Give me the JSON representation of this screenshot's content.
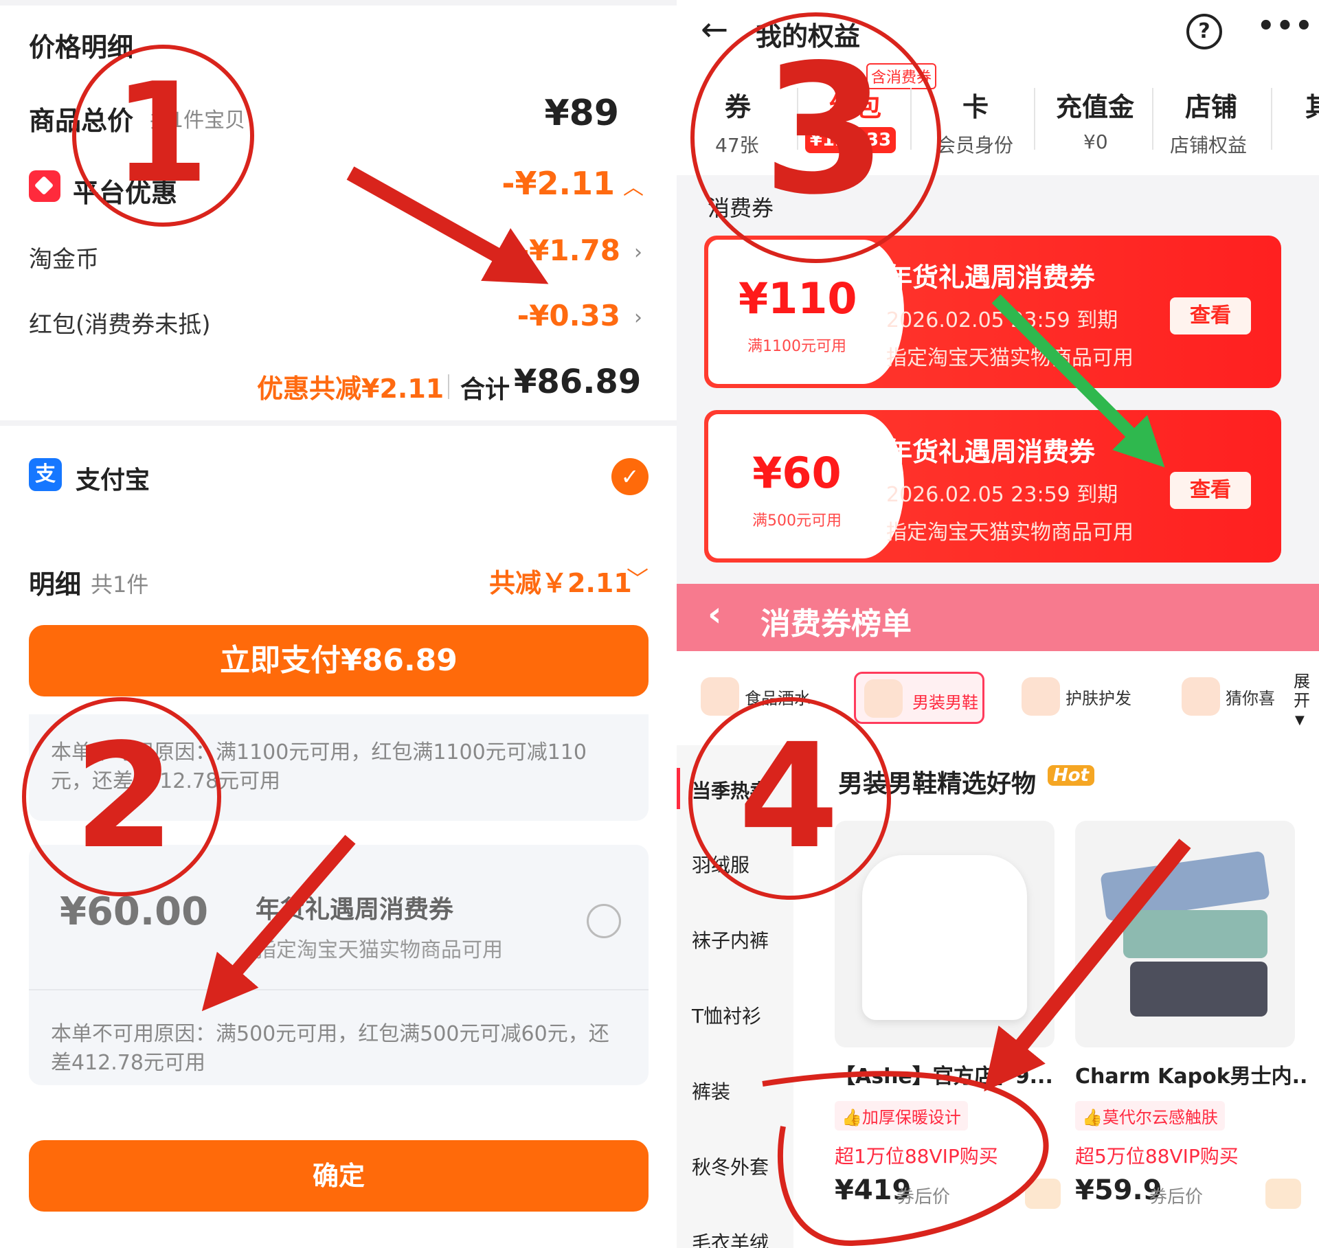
{
  "left_top": {
    "section_title": "价格明细",
    "goods_total_label": "商品总价",
    "goods_total_sub": "共1件宝贝",
    "goods_total_value": "¥89",
    "platform_discount_label": "平台优惠",
    "platform_discount_value": "-¥2.11",
    "taojinbi_label": "淘金币",
    "taojinbi_value": "-¥1.78",
    "hongbao_label": "红包(消费券未抵)",
    "hongbao_value": "-¥0.33",
    "total_discount": "优惠共减¥2.11",
    "total_sum_label": "合计",
    "total_sum_value": "¥86.89",
    "payment_method": "支付宝"
  },
  "left_bottom": {
    "detail_title": "明细",
    "detail_count": "共1件",
    "detail_discount": "共减￥2.11",
    "pay_button": "立即支付¥86.89",
    "reason1": "本单不可用原因：满1100元可用，红包满1100元可减110元，还差1012.78元可用",
    "coupon_amount": "¥60.00",
    "coupon_title": "年货礼遇周消费券",
    "coupon_desc": "指定淘宝天猫实物商品可用",
    "reason2": "本单不可用原因：满500元可用，红包满500元可减60元，还差412.78元可用",
    "confirm_button": "确定"
  },
  "right_top": {
    "header_title": "我的权益",
    "tabs": [
      {
        "label": "券",
        "sub": "47张"
      },
      {
        "label": "红包",
        "sub": "¥127.33",
        "badge": "含消费券"
      },
      {
        "label": "卡",
        "sub": "会员身份"
      },
      {
        "label": "充值金",
        "sub": "¥0"
      },
      {
        "label": "店铺",
        "sub": "店铺权益"
      },
      {
        "label": "其"
      }
    ],
    "section_label": "消费券",
    "coupons": [
      {
        "amount": "¥110",
        "cond": "满1100元可用",
        "title": "年货礼遇周消费券",
        "expire": "2026.02.05 23:59 到期",
        "desc": "指定淘宝天猫实物商品可用",
        "button": "查看"
      },
      {
        "amount": "¥60",
        "cond": "满500元可用",
        "title": "年货礼遇周消费券",
        "expire": "2026.02.05 23:59 到期",
        "desc": "指定淘宝天猫实物商品可用",
        "button": "查看"
      }
    ]
  },
  "right_bottom": {
    "banner_title": "消费券榜单",
    "categories": [
      "食品酒水",
      "男装男鞋",
      "护肤护发",
      "猜你喜"
    ],
    "expand_label": "展开",
    "sidebar": [
      "当季热卖",
      "羽绒服",
      "袜子内裤",
      "T恤衬衫",
      "裤装",
      "秋冬外套",
      "毛衣羊绒"
    ],
    "section_title": "男装男鞋精选好物",
    "hot_badge": "Hot",
    "products": [
      {
        "title": "【Ashe】官方店】9...",
        "tag": "加厚保暖设计",
        "buyers": "超1万位88VIP购买",
        "price": "¥419",
        "price_note": "券后价"
      },
      {
        "title": "Charm Kapok男士内...",
        "tag": "莫代尔云感触肤",
        "buyers": "超5万位88VIP购买",
        "price": "¥59.9",
        "price_note": "券后价"
      }
    ]
  },
  "annotations": [
    "1",
    "2",
    "3",
    "4"
  ],
  "colors": {
    "accent_orange": "#ff6a0a",
    "coupon_red": "#ff2a20",
    "annotation_red": "#d9241c",
    "arrow_green": "#2fb84e",
    "banner_pink": "#f77a8e"
  }
}
